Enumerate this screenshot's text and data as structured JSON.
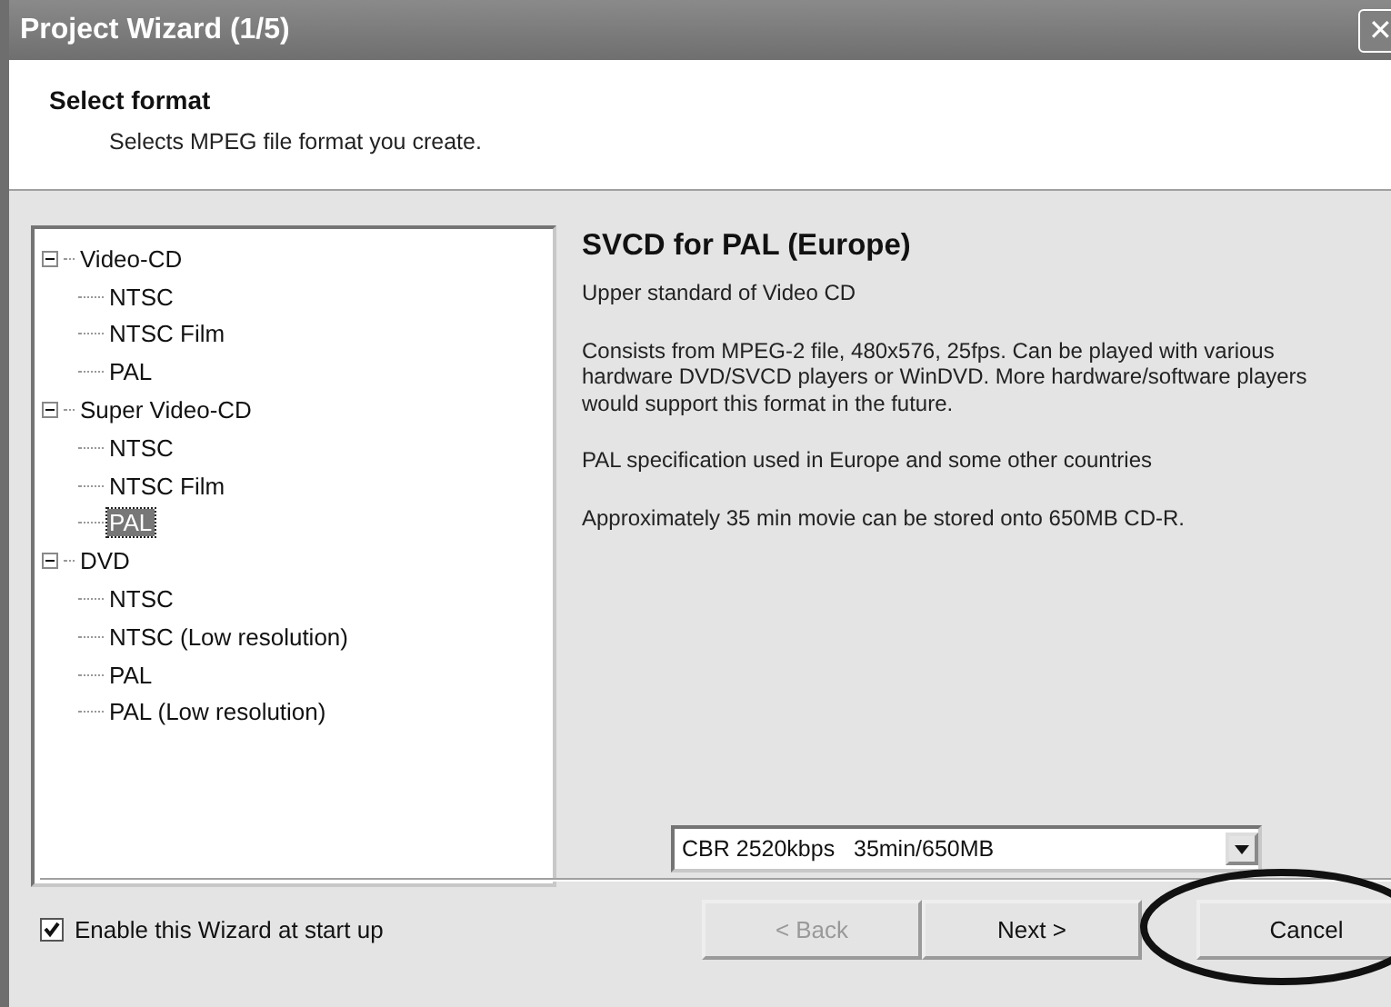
{
  "window": {
    "title": "Project Wizard (1/5)",
    "close": "✕"
  },
  "header": {
    "title": "Select format",
    "subtitle": "Selects MPEG file format you create."
  },
  "tree": [
    {
      "label": "Video-CD",
      "expanded": true,
      "selected": false,
      "children": [
        {
          "label": "NTSC",
          "selected": false
        },
        {
          "label": "NTSC Film",
          "selected": false
        },
        {
          "label": "PAL",
          "selected": false
        }
      ]
    },
    {
      "label": "Super Video-CD",
      "expanded": true,
      "selected": false,
      "children": [
        {
          "label": "NTSC",
          "selected": false
        },
        {
          "label": "NTSC Film",
          "selected": false
        },
        {
          "label": "PAL",
          "selected": true
        }
      ]
    },
    {
      "label": "DVD",
      "expanded": true,
      "selected": false,
      "children": [
        {
          "label": "NTSC",
          "selected": false
        },
        {
          "label": "NTSC (Low resolution)",
          "selected": false
        },
        {
          "label": "PAL",
          "selected": false
        },
        {
          "label": "PAL (Low resolution)",
          "selected": false
        }
      ]
    }
  ],
  "details": {
    "title": "SVCD for PAL (Europe)",
    "paragraphs": [
      "Upper standard of Video CD",
      "Consists from MPEG-2 file, 480x576, 25fps. Can be played with various hardware DVD/SVCD players or WinDVD. More hardware/software players would support this format in the future.",
      "PAL specification used in Europe and some other countries",
      "Approximately 35 min movie can be stored onto 650MB CD-R."
    ]
  },
  "bitrate_select": {
    "value": "CBR 2520kbps   35min/650MB"
  },
  "startup_checkbox": {
    "label": "Enable this Wizard at start up",
    "checked": true
  },
  "buttons": [
    {
      "label": "< Back",
      "disabled": true,
      "circled": false
    },
    {
      "label": "Next >",
      "disabled": false,
      "circled": false
    },
    {
      "label": "Cancel",
      "disabled": false,
      "circled": true
    }
  ]
}
